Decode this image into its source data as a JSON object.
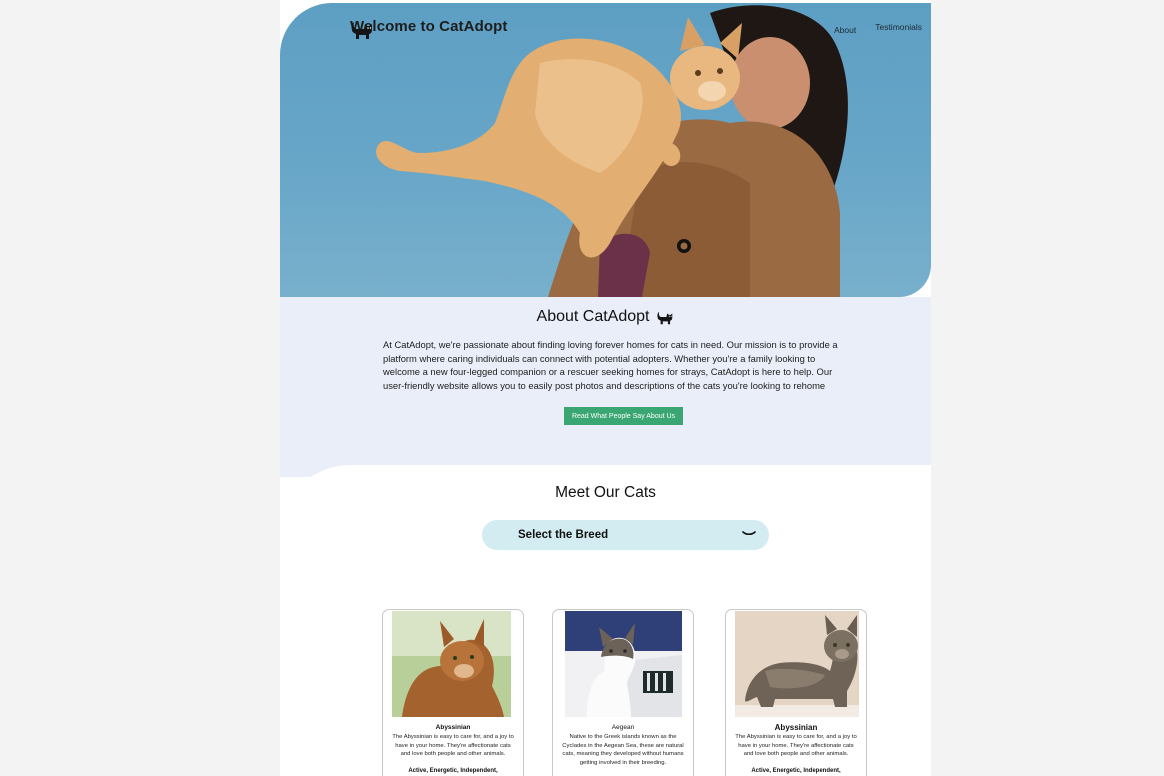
{
  "header": {
    "brand": "Welcome to CatAdopt",
    "nav": [
      "About",
      "Testimonials"
    ]
  },
  "about": {
    "title": "About CatAdopt",
    "body": "At CatAdopt, we're passionate about finding loving forever homes for cats in need. Our mission is to provide a platform where caring individuals can connect with potential adopters. Whether you're a family looking to welcome a new four-legged companion or a rescuer seeking homes for strays, CatAdopt is here to help. Our user-friendly website allows you to easily post photos and descriptions of the cats you're looking to rehome",
    "button": "Read  What People Say About Us"
  },
  "meet": {
    "title": "Meet Our Cats",
    "select_label": "Select the Breed"
  },
  "cards": [
    {
      "name": "Abyssinian",
      "description": "The Abyssinian is easy to care for, and a joy to have in your home. They're affectionate cats and love both people and other animals.",
      "traits": "Active, Energetic, Independent,"
    },
    {
      "name": "Aegean",
      "description": "Native to the Greek islands known as the Cyclades in the Aegean Sea, these are natural cats, meaning they developed without humans getting involved in their breeding."
    },
    {
      "name": "Abyssinian",
      "description": "The Abyssinian is easy to care for, and a joy to have in your home. They're affectionate cats and love both people and other animals.",
      "traits": "Active, Energetic, Independent,"
    }
  ],
  "icons": {
    "logo": "cat-silhouette-icon",
    "select": "chevron-down-icon",
    "github": "github-icon"
  },
  "colors": {
    "hero_sky": "#68a6c8",
    "about_bg": "#e9eef8",
    "button": "#3aa672",
    "select_bg": "#d3ecf1"
  }
}
